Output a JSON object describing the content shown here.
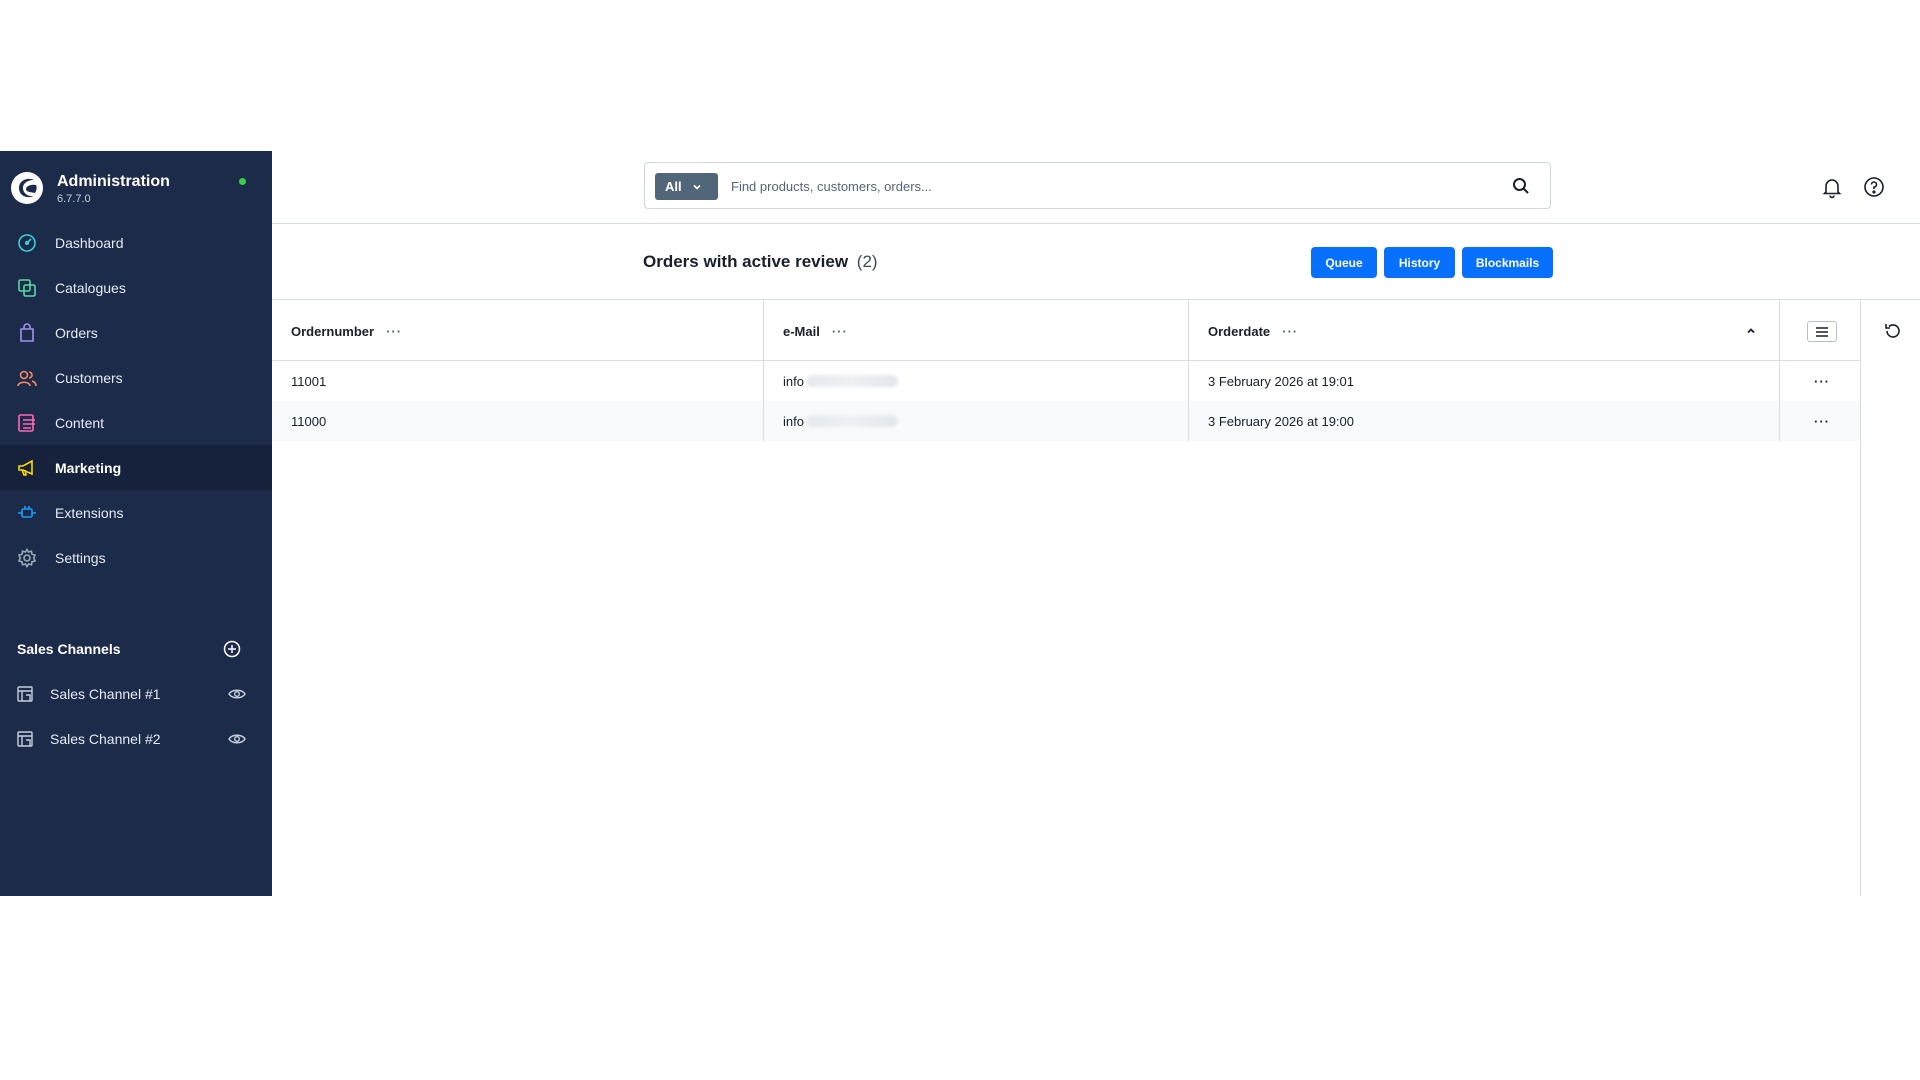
{
  "brand": {
    "name": "Administration",
    "version": "6.7.7.0"
  },
  "nav": [
    {
      "label": "Dashboard",
      "icon": "dashboard-icon",
      "color": "#3ad0d9"
    },
    {
      "label": "Catalogues",
      "icon": "catalogue-icon",
      "color": "#57d9a3"
    },
    {
      "label": "Orders",
      "icon": "orders-icon",
      "color": "#a092f0"
    },
    {
      "label": "Customers",
      "icon": "customers-icon",
      "color": "#f88962"
    },
    {
      "label": "Content",
      "icon": "content-icon",
      "color": "#ff68b4"
    },
    {
      "label": "Marketing",
      "icon": "marketing-icon",
      "color": "#ffd700",
      "active": true
    },
    {
      "label": "Extensions",
      "icon": "extensions-icon",
      "color": "#189eff"
    },
    {
      "label": "Settings",
      "icon": "settings-icon",
      "color": "#9aa8b5"
    }
  ],
  "sales_channels": {
    "title": "Sales Channels",
    "items": [
      {
        "label": "Sales Channel #1"
      },
      {
        "label": "Sales Channel #2"
      }
    ]
  },
  "search": {
    "type": "All",
    "placeholder": "Find products, customers, orders..."
  },
  "page": {
    "title": "Orders with active review",
    "count": "(2)",
    "buttons": {
      "queue": "Queue",
      "history": "History",
      "blockmails": "Blockmails"
    }
  },
  "grid": {
    "columns": {
      "ordernumber": "Ordernumber",
      "email": "e-Mail",
      "orderdate": "Orderdate"
    },
    "dots": "···",
    "rows": [
      {
        "ordernumber": "11001",
        "email_visible": "info",
        "orderdate": "3 February 2026 at 19:01"
      },
      {
        "ordernumber": "11000",
        "email_visible": "info",
        "orderdate": "3 February 2026 at 19:00"
      }
    ]
  },
  "colors": {
    "sidebar": "#1c2b4a",
    "primary": "#0870ff",
    "online": "#37d046"
  }
}
